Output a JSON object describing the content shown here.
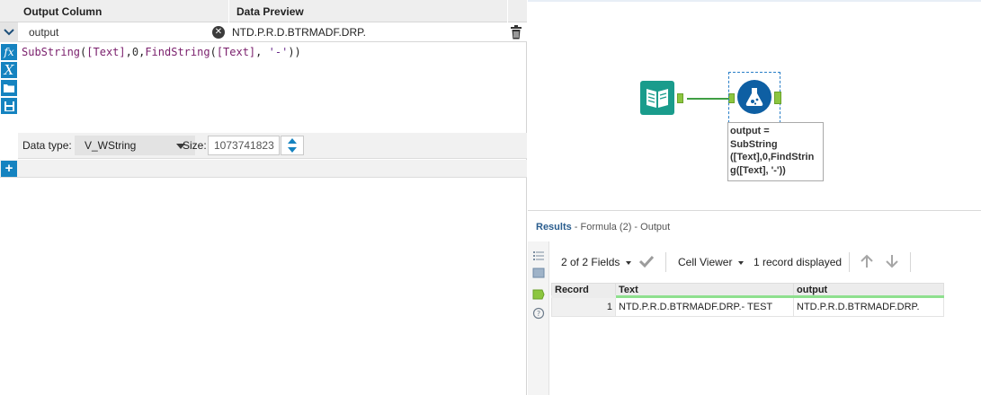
{
  "config": {
    "header": {
      "output_column": "Output Column",
      "data_preview": "Data Preview"
    },
    "expression": {
      "column_name": "output",
      "preview": "NTD.P.R.D.BTRMADF.DRP.",
      "code": {
        "fn1": "SubString",
        "p1": "(",
        "f1": "[Text]",
        "c1": ",",
        "n1": "0",
        "c2": ",",
        "fn2": "FindString",
        "p2": "(",
        "f2": "[Text]",
        "c3": ", ",
        "s1": "'-'",
        "p3": "))"
      }
    },
    "tools": [
      "fx-icon",
      "variable-icon",
      "folder-icon",
      "save-icon"
    ],
    "data_type_label": "Data type:",
    "data_type_value": "V_WString",
    "size_label": "Size:",
    "size_value": "1073741823"
  },
  "canvas": {
    "annotation": "output =\nSubString\n([Text],0,FindStrin\ng([Text], '-'))"
  },
  "results": {
    "title": "Results",
    "subtitle": " - Formula (2) - Output",
    "fields": "2 of 2 Fields",
    "cell_viewer": "Cell Viewer",
    "records": "1 record displayed",
    "columns": [
      "Record",
      "Text",
      "output"
    ],
    "rows": [
      {
        "record": "1",
        "text": "NTD.P.R.D.BTRMADF.DRP.- TEST",
        "output": "NTD.P.R.D.BTRMADF.DRP."
      }
    ]
  },
  "colors": {
    "accent": "#1583c0",
    "formula_tool": "#0e5fa3",
    "input_tool": "#1a9c8c",
    "connection": "#3f9f44",
    "field_highlight": "#8ee08e"
  }
}
